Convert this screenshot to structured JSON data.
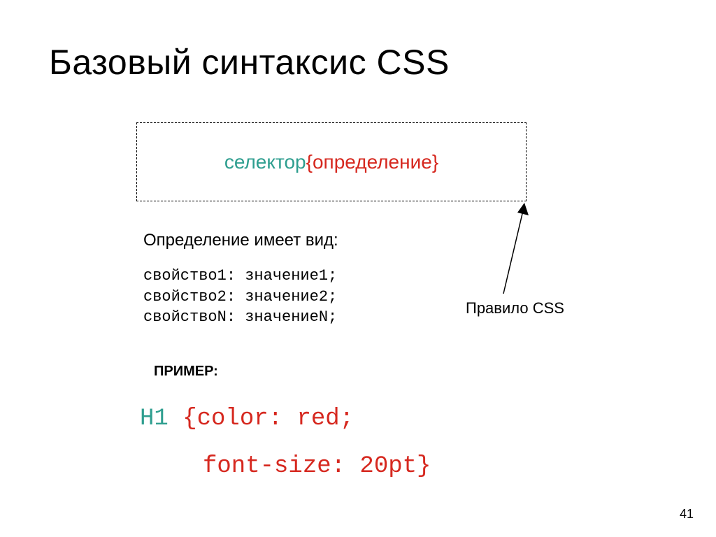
{
  "title": "Базовый синтаксис CSS",
  "syntax": {
    "selector": "селектор",
    "open": " { ",
    "definition": "определение",
    "close": " }"
  },
  "defLabel": "Определение имеет вид:",
  "defLines": {
    "l1": "свойство1: значение1;",
    "l2": "свойство2: значение2;",
    "l3": "свойствоN: значениеN;"
  },
  "ruleLabel": "Правило CSS",
  "exampleLabel": "ПРИМЕР:",
  "example": {
    "selector": "H1",
    "line1": " {color: red;",
    "line2": "font-size: 20pt}"
  },
  "pageNumber": "41"
}
